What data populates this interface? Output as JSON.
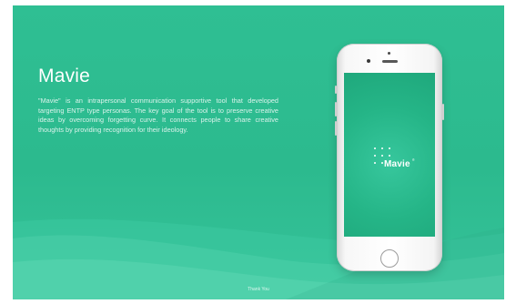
{
  "slide": {
    "title": "Mavie",
    "description": "\"Mavie\" is an intrapersonal communication supportive tool that developed targeting ENTP type personas. The key goal of the tool is to preserve creative ideas by overcoming forgetting curve. It connects people to share creative thoughts by providing recognition for their ideology.",
    "footer": "Thank You"
  },
  "phone": {
    "app_name": "Mavie",
    "registered_mark": "®",
    "home_button_icon": "home-button-icon",
    "logo_icon": "dot-grid-icon"
  },
  "colors": {
    "background": "#2cba8e",
    "screen": "#25b587",
    "text": "#ffffff"
  }
}
